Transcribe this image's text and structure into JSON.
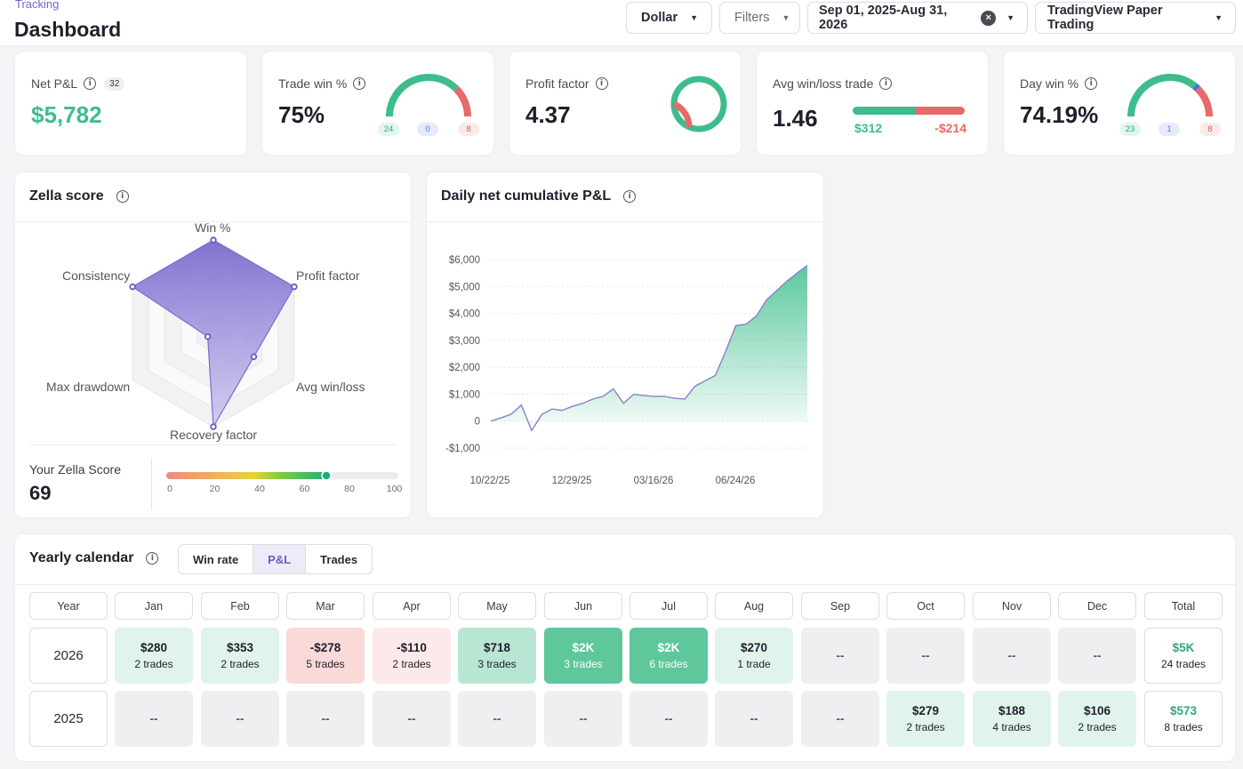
{
  "header": {
    "breadcrumb": "Tracking",
    "title": "Dashboard",
    "currency_label": "Dollar",
    "filters_label": "Filters",
    "date_range": "Sep 01, 2025-Aug 31, 2026",
    "account_label": "TradingView Paper Trading"
  },
  "stats": {
    "net_pnl": {
      "label": "Net P&L",
      "count": "32",
      "value": "$5,782"
    },
    "trade_win": {
      "label": "Trade win %",
      "value": "75%",
      "wins": "24",
      "breakeven": "0",
      "losses": "8",
      "gauge": {
        "win": 24,
        "breakeven": 0,
        "loss": 8
      }
    },
    "profit_factor": {
      "label": "Profit factor",
      "value": "4.37",
      "ring": {
        "profit": 4.37,
        "loss": 1
      }
    },
    "avg_win_loss": {
      "label": "Avg win/loss trade",
      "value": "1.46",
      "avg_win": "$312",
      "avg_loss": "-$214",
      "bar": {
        "win": 312,
        "loss": 214
      }
    },
    "day_win": {
      "label": "Day win %",
      "value": "74.19%",
      "wins": "23",
      "breakeven": "1",
      "losses": "8",
      "gauge": {
        "win": 23,
        "breakeven": 1,
        "loss": 8
      }
    }
  },
  "zella": {
    "title": "Zella score",
    "axes": [
      "Win %",
      "Profit factor",
      "Avg win/loss",
      "Recovery factor",
      "Max drawdown",
      "Consistency"
    ],
    "values": [
      1.0,
      1.0,
      0.5,
      1.0,
      0.0,
      1.0
    ],
    "score_label": "Your Zella Score",
    "score": "69",
    "score_value": 69,
    "scale_ticks": [
      "0",
      "20",
      "40",
      "60",
      "80",
      "100"
    ]
  },
  "chart_data": {
    "type": "area",
    "title": "Daily net cumulative P&L",
    "x_ticks": [
      "10/22/25",
      "12/29/25",
      "03/16/26",
      "06/24/26"
    ],
    "y_ticks": [
      "$6,000",
      "$5,000",
      "$4,000",
      "$3,000",
      "$2,000",
      "$1,000",
      "0",
      "-$1,000"
    ],
    "ylim": [
      -1000,
      6000
    ],
    "series": [
      {
        "values": [
          0,
          120,
          260,
          600,
          -350,
          250,
          450,
          400,
          550,
          660,
          820,
          920,
          1200,
          660,
          1000,
          950,
          920,
          920,
          850,
          820,
          1300,
          1500,
          1700,
          2600,
          3550,
          3600,
          3900,
          4500,
          4850,
          5200,
          5500,
          5782
        ]
      }
    ],
    "grid": true,
    "colors": {
      "line": "#8a7fcf",
      "fill": "#3fbf8c"
    }
  },
  "calendar": {
    "title": "Yearly calendar",
    "tabs": [
      "Win rate",
      "P&L",
      "Trades"
    ],
    "active_tab": "P&L",
    "headers": [
      "Year",
      "Jan",
      "Feb",
      "Mar",
      "Apr",
      "May",
      "Jun",
      "Jul",
      "Aug",
      "Sep",
      "Oct",
      "Nov",
      "Dec",
      "Total"
    ],
    "rows": [
      {
        "year": "2026",
        "cells": [
          {
            "v": "$280",
            "t": "2 trades",
            "c": "lg"
          },
          {
            "v": "$353",
            "t": "2 trades",
            "c": "lg"
          },
          {
            "v": "-$278",
            "t": "5 trades",
            "c": "mr"
          },
          {
            "v": "-$110",
            "t": "2 trades",
            "c": "lr"
          },
          {
            "v": "$718",
            "t": "3 trades",
            "c": "mg"
          },
          {
            "v": "$2K",
            "t": "3 trades",
            "c": "dg"
          },
          {
            "v": "$2K",
            "t": "6 trades",
            "c": "dg"
          },
          {
            "v": "$270",
            "t": "1 trade",
            "c": "lg"
          },
          {
            "v": "--",
            "t": "",
            "c": "empty"
          },
          {
            "v": "--",
            "t": "",
            "c": "empty"
          },
          {
            "v": "--",
            "t": "",
            "c": "empty"
          },
          {
            "v": "--",
            "t": "",
            "c": "empty"
          }
        ],
        "total": {
          "v": "$5K",
          "t": "24 trades"
        }
      },
      {
        "year": "2025",
        "cells": [
          {
            "v": "--",
            "t": "",
            "c": "empty"
          },
          {
            "v": "--",
            "t": "",
            "c": "empty"
          },
          {
            "v": "--",
            "t": "",
            "c": "empty"
          },
          {
            "v": "--",
            "t": "",
            "c": "empty"
          },
          {
            "v": "--",
            "t": "",
            "c": "empty"
          },
          {
            "v": "--",
            "t": "",
            "c": "empty"
          },
          {
            "v": "--",
            "t": "",
            "c": "empty"
          },
          {
            "v": "--",
            "t": "",
            "c": "empty"
          },
          {
            "v": "--",
            "t": "",
            "c": "empty"
          },
          {
            "v": "$279",
            "t": "2 trades",
            "c": "lg"
          },
          {
            "v": "$188",
            "t": "4 trades",
            "c": "lg"
          },
          {
            "v": "$106",
            "t": "2 trades",
            "c": "lg"
          }
        ],
        "total": {
          "v": "$573",
          "t": "8 trades"
        }
      }
    ]
  },
  "colors": {
    "accent": "#7b5fd0",
    "green": "#3ebd8c",
    "red": "#e66a6a",
    "blue": "#4a6fd8"
  }
}
